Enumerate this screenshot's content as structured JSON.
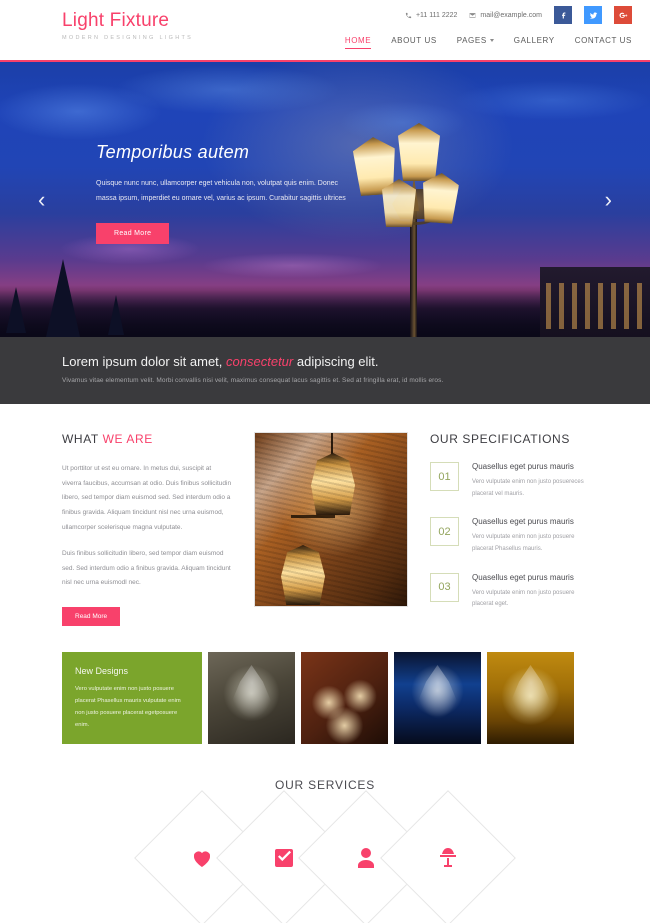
{
  "header": {
    "logo": "Light Fixture",
    "tagline": "Modern Designing Lights",
    "phone": "+11 111 2222",
    "email": "mail@example.com",
    "social": [
      {
        "name": "facebook",
        "glyph": "f"
      },
      {
        "name": "twitter",
        "glyph": "t"
      },
      {
        "name": "google-plus",
        "glyph": "G+"
      }
    ],
    "nav": [
      {
        "label": "HOME",
        "active": true,
        "dropdown": false
      },
      {
        "label": "ABOUT US",
        "active": false,
        "dropdown": false
      },
      {
        "label": "PAGES",
        "active": false,
        "dropdown": true
      },
      {
        "label": "GALLERY",
        "active": false,
        "dropdown": false
      },
      {
        "label": "CONTACT US",
        "active": false,
        "dropdown": false
      }
    ]
  },
  "hero": {
    "title": "Temporibus autem",
    "text": "Quisque nunc nunc, ullamcorper eget vehicula non, volutpat quis enim. Donec massa ipsum, imperdiet eu ornare vel, varius ac ipsum. Curabitur sagittis ultrices",
    "button": "Read More",
    "prev_arrow": "‹",
    "next_arrow": "›"
  },
  "banner": {
    "title_start": "Lorem ipsum dolor sit amet,",
    "title_em": "consectetur",
    "title_end": "adipiscing elit.",
    "subtitle": "Vivamus vitae elementum velit. Morbi convallis nisi velit, maximus consequat lacus sagittis et. Sed at fringilla erat, id mollis eros."
  },
  "about": {
    "title_dark": "WHAT",
    "title_pink": "WE ARE",
    "paragraph1": "Ut porttitor ut est eu ornare. In metus dui, suscipit at viverra faucibus, accumsan at odio. Duis finibus sollicitudin libero, sed tempor diam euismod sed. Sed interdum odio a finibus gravida. Aliquam tincidunt nisl nec urna euismod, ullamcorper scelerisque magna vulputate.",
    "paragraph2": "Duis finibus sollicitudin libero, sed tempor diam euismod sed. Sed interdum odio a finibus gravida. Aliquam tincidunt nisl nec urna euismodl nec.",
    "button": "Read More",
    "image_alt": "hanging lanterns on brick wall"
  },
  "specifications": {
    "title": "OUR SPECIFICATIONS",
    "items": [
      {
        "number": "01",
        "heading": "Quasellus eget purus mauris",
        "text": "Vero vulputate enim non justo posuereces placerat vel mauris."
      },
      {
        "number": "02",
        "heading": "Quasellus eget purus mauris",
        "text": "Vero vulputate enim non justo posuere placerat Phasellus mauris."
      },
      {
        "number": "03",
        "heading": "Quasellus eget purus mauris",
        "text": "Vero vulputate enim non justo posuere placerat eget."
      }
    ]
  },
  "gallery": {
    "promo": {
      "title": "New Designs",
      "text": "Vero vulputate enim non justo posuere placerat Phasellus mauris vulputate enim non justo posuere placerat egetposuere enim.",
      "bg_color": "#7ba52c"
    },
    "images": [
      {
        "alt": "crystal chandelier sepia"
      },
      {
        "alt": "ceiling fan light fixture"
      },
      {
        "alt": "crystal chandelier blue backdrop"
      },
      {
        "alt": "golden chandelier glowing"
      }
    ]
  },
  "services": {
    "title": "OUR SERVICES",
    "items": [
      {
        "icon": "heart-icon"
      },
      {
        "icon": "check-square-icon"
      },
      {
        "icon": "user-icon"
      },
      {
        "icon": "lamp-icon"
      }
    ]
  },
  "colors": {
    "accent_pink": "#f8416b",
    "banner_dark": "#3a3a3d",
    "green": "#7ba52c",
    "spec_olive": "#93a55e"
  }
}
